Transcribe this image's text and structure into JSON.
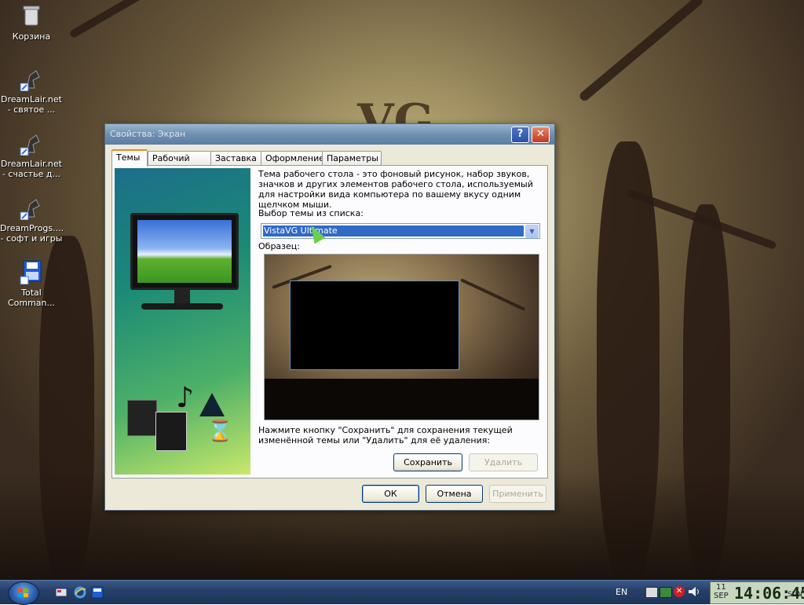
{
  "desktop": {
    "watermark_text": "VG",
    "icons": [
      {
        "label": "Корзина",
        "icon": "recycle-bin-icon"
      },
      {
        "label": "DreamLair.net\n- святое ...",
        "icon": "shortcut-icon"
      },
      {
        "label": "DreamLair.net\n- счастье д...",
        "icon": "shortcut-icon"
      },
      {
        "label": "DreamProgs....\n- софт и игры",
        "icon": "shortcut-icon"
      },
      {
        "label": "Total\nComman...",
        "icon": "total-commander-icon"
      }
    ]
  },
  "window": {
    "title": "Свойства: Экран",
    "help_glyph": "?",
    "close_glyph": "✕",
    "tabs": [
      "Темы",
      "Рабочий стол",
      "Заставка",
      "Оформление",
      "Параметры"
    ],
    "active_tab": "Темы",
    "description": "Тема рабочего стола - это фоновый рисунок, набор звуков, значков и других элементов рабочего стола, используемый для настройки вида компьютера по вашему вкусу одним щелчком мыши.",
    "theme_label": "Выбор темы из списка:",
    "theme_value": "VistaVG Ultimate",
    "sample_label": "Образец:",
    "save_hint": "Нажмите кнопку \"Сохранить\" для сохранения текущей изменённой темы или \"Удалить\" для её удаления:",
    "save_button": "Сохранить",
    "delete_button": "Удалить",
    "ok_button": "ОК",
    "cancel_button": "Отмена",
    "apply_button": "Применить"
  },
  "taskbar": {
    "language": "EN",
    "clock": {
      "day": "11",
      "month": "SEP",
      "time": "14:06:45",
      "weekday": "SUN"
    }
  }
}
